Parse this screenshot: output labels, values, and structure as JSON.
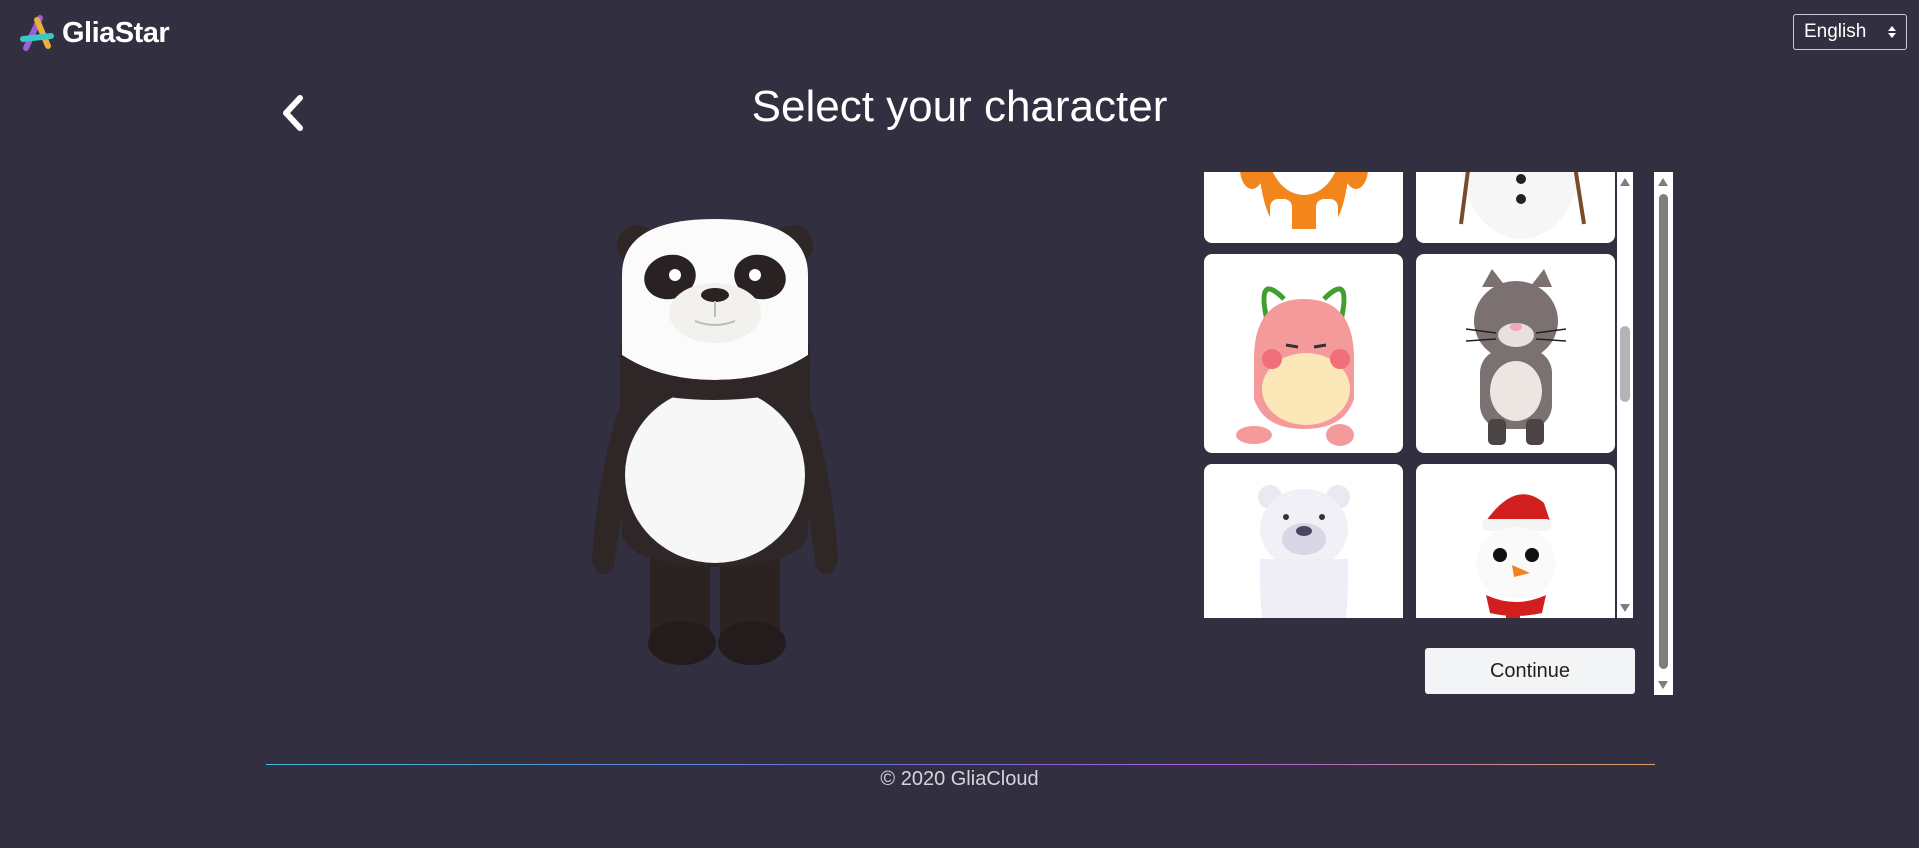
{
  "header": {
    "brand_name": "GliaStar",
    "logo_icon": "gliastar-logo-icon",
    "language_select": {
      "selected": "English"
    }
  },
  "page": {
    "title": "Select your character",
    "back_icon": "chevron-left-icon"
  },
  "selected_character": "panda",
  "character_grid": [
    {
      "name": "tiger"
    },
    {
      "name": "snowman-partial"
    },
    {
      "name": "pink-radish"
    },
    {
      "name": "gray-cat"
    },
    {
      "name": "polar-bear"
    },
    {
      "name": "snowman"
    }
  ],
  "actions": {
    "continue_label": "Continue"
  },
  "footer": {
    "copyright": "© 2020 GliaCloud"
  },
  "colors": {
    "background": "#312f40",
    "card": "#ffffff",
    "button": "#f3f4f6"
  }
}
